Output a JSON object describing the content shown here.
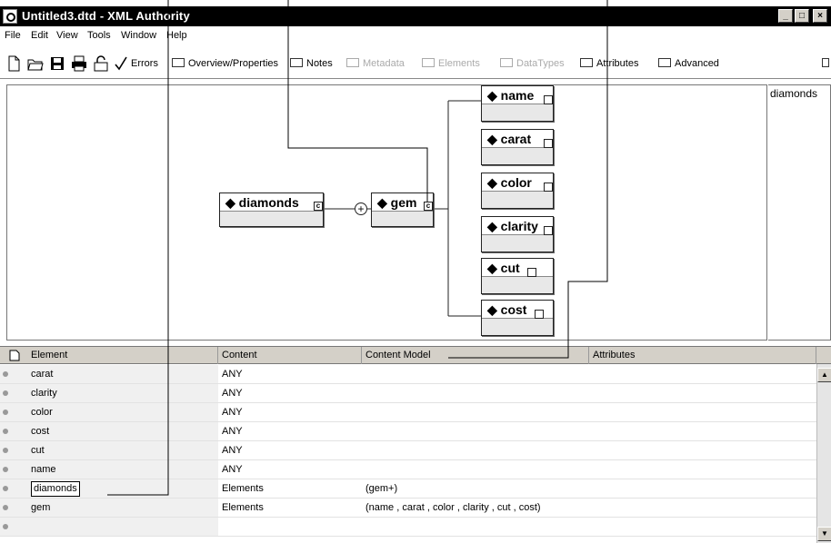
{
  "window": {
    "title": "Untitled3.dtd - XML Authority",
    "buttons": {
      "minimize": "_",
      "maximize": "□",
      "close": "×"
    }
  },
  "menu": [
    "File",
    "Edit",
    "View",
    "Tools",
    "Window",
    "Help"
  ],
  "toolbar": {
    "errors": "Errors",
    "overview": "Overview/Properties",
    "notes": "Notes",
    "metadata": "Metadata",
    "elements": "Elements",
    "datatypes": "DataTypes",
    "attributes": "Attributes",
    "advanced": "Advanced"
  },
  "diagram": {
    "root": "diamonds",
    "sequence_symbol": "+",
    "child": "gem",
    "leaves": [
      "name",
      "carat",
      "color",
      "clarity",
      "cut",
      "cost"
    ],
    "complex_marker": "c",
    "simple_marker": "a"
  },
  "right_panel": {
    "header": "diamonds"
  },
  "grid": {
    "headers": [
      "Element",
      "Content",
      "Content Model",
      "Attributes"
    ],
    "rows": [
      {
        "element": "carat",
        "content": "ANY",
        "model": ""
      },
      {
        "element": "clarity",
        "content": "ANY",
        "model": ""
      },
      {
        "element": "color",
        "content": "ANY",
        "model": ""
      },
      {
        "element": "cost",
        "content": "ANY",
        "model": ""
      },
      {
        "element": "cut",
        "content": "ANY",
        "model": ""
      },
      {
        "element": "name",
        "content": "ANY",
        "model": ""
      },
      {
        "element": "diamonds",
        "content": "Elements",
        "model": "(gem+)"
      },
      {
        "element": "gem",
        "content": "Elements",
        "model": "(name , carat , color , clarity , cut , cost)"
      }
    ]
  },
  "icons": {
    "new": "new-document-icon",
    "open": "open-folder-icon",
    "save": "save-icon",
    "print": "print-icon",
    "lock": "lock-icon",
    "check": "checkmark-icon"
  },
  "colors": {
    "titlebar": "#000000",
    "chrome": "#d4d0c8",
    "node_body": "#e8e8e8"
  }
}
